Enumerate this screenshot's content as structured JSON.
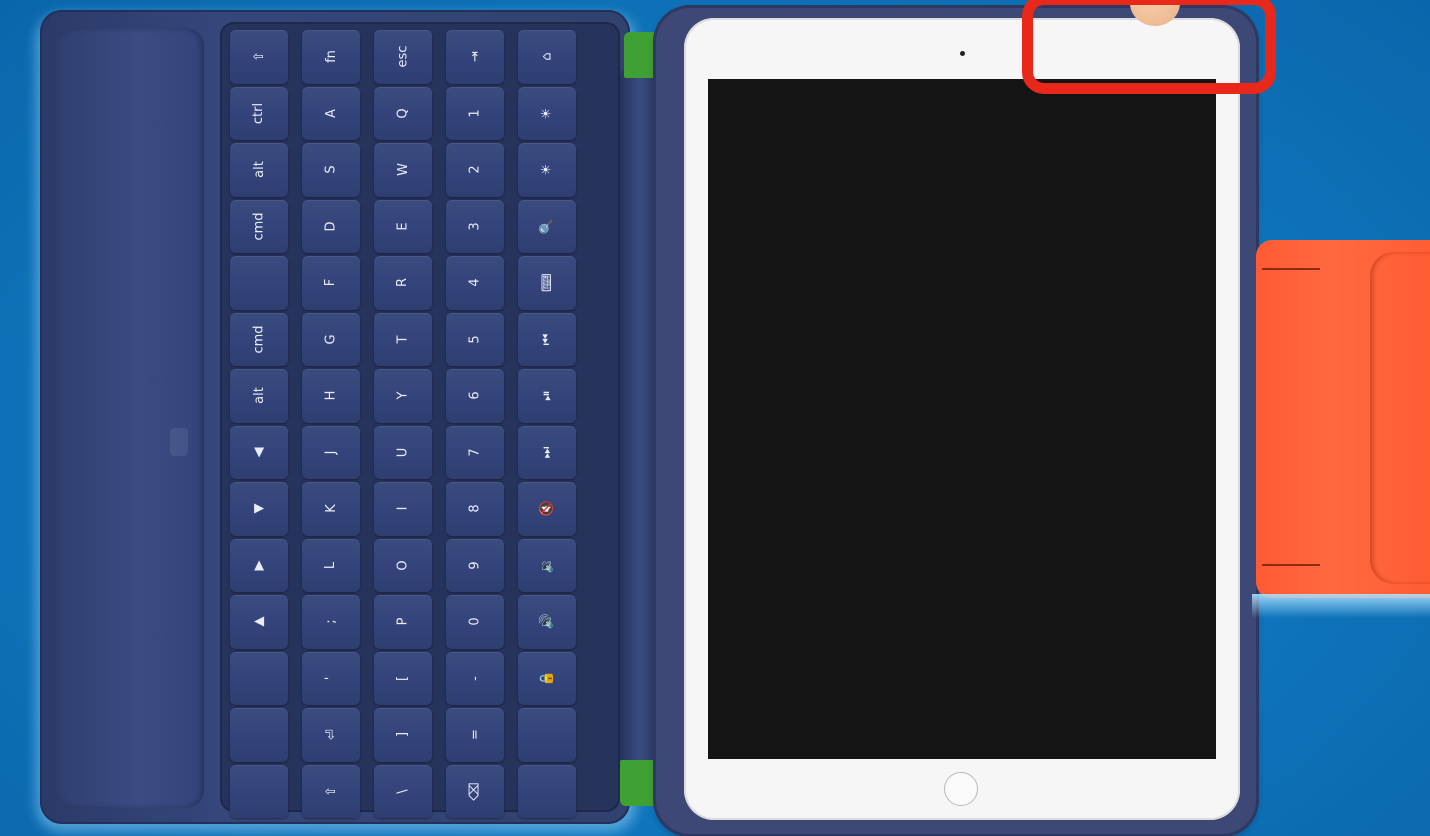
{
  "scene": {
    "subject": "tablet-in-keyboard-case",
    "colors": {
      "background": "#1179c0",
      "folio": "#34467a",
      "hinge": "#3fa033",
      "tablet_bezel": "#f6f6f6",
      "screen": "#141414",
      "handle": "#ff6a40",
      "highlight": "#e8281a"
    }
  },
  "keyboard": {
    "keys": [
      "⇧",
      "ctrl",
      "alt",
      "cmd",
      "",
      "cmd",
      "alt",
      "◀",
      "▼",
      "▶",
      "▲",
      "",
      "",
      "",
      "fn",
      "A",
      "S",
      "D",
      "F",
      "G",
      "H",
      "J",
      "K",
      "L",
      ";",
      "'",
      "⏎",
      "⇧",
      "esc",
      "Q",
      "W",
      "E",
      "R",
      "T",
      "Y",
      "U",
      "I",
      "O",
      "P",
      "[",
      "]",
      "\\",
      "⇥",
      "1",
      "2",
      "3",
      "4",
      "5",
      "6",
      "7",
      "8",
      "9",
      "0",
      "-",
      "=",
      "⌫",
      "⌂",
      "☀",
      "☀",
      "🔍",
      "⌨",
      "⏮",
      "⏯",
      "⏭",
      "🔇",
      "🔉",
      "🔊",
      "🔒",
      "",
      ""
    ]
  },
  "annotation": {
    "type": "highlight-box",
    "target": "top-button"
  }
}
